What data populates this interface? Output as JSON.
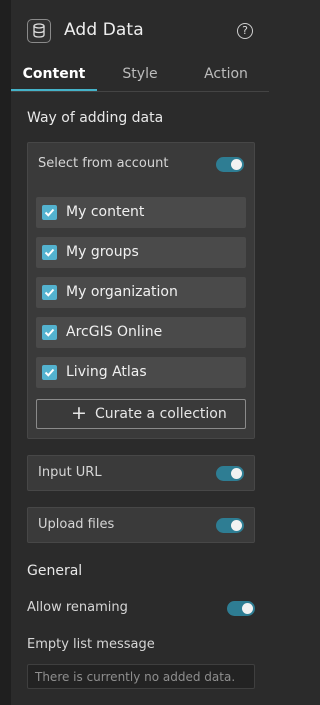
{
  "header": {
    "title": "Add Data",
    "help_glyph": "?"
  },
  "tabs": [
    {
      "label": "Content",
      "active": true
    },
    {
      "label": "Style",
      "active": false
    },
    {
      "label": "Action",
      "active": false
    }
  ],
  "way_section": {
    "title": "Way of adding data",
    "select_from_account": {
      "label": "Select from account",
      "enabled": true,
      "options": [
        {
          "label": "My content",
          "checked": true
        },
        {
          "label": "My groups",
          "checked": true
        },
        {
          "label": "My organization",
          "checked": true
        },
        {
          "label": "ArcGIS Online",
          "checked": true
        },
        {
          "label": "Living Atlas",
          "checked": true
        }
      ],
      "curate_label": "Curate a collection"
    },
    "input_url": {
      "label": "Input URL",
      "enabled": true
    },
    "upload_files": {
      "label": "Upload files",
      "enabled": true
    }
  },
  "general": {
    "title": "General",
    "allow_renaming": {
      "label": "Allow renaming",
      "enabled": true
    },
    "empty_list": {
      "label": "Empty list message",
      "placeholder": "There is currently no added data."
    }
  },
  "colors": {
    "accent": "#45b3c9",
    "toggle_on": "#2e7d93",
    "checkbox": "#53b2cf"
  }
}
